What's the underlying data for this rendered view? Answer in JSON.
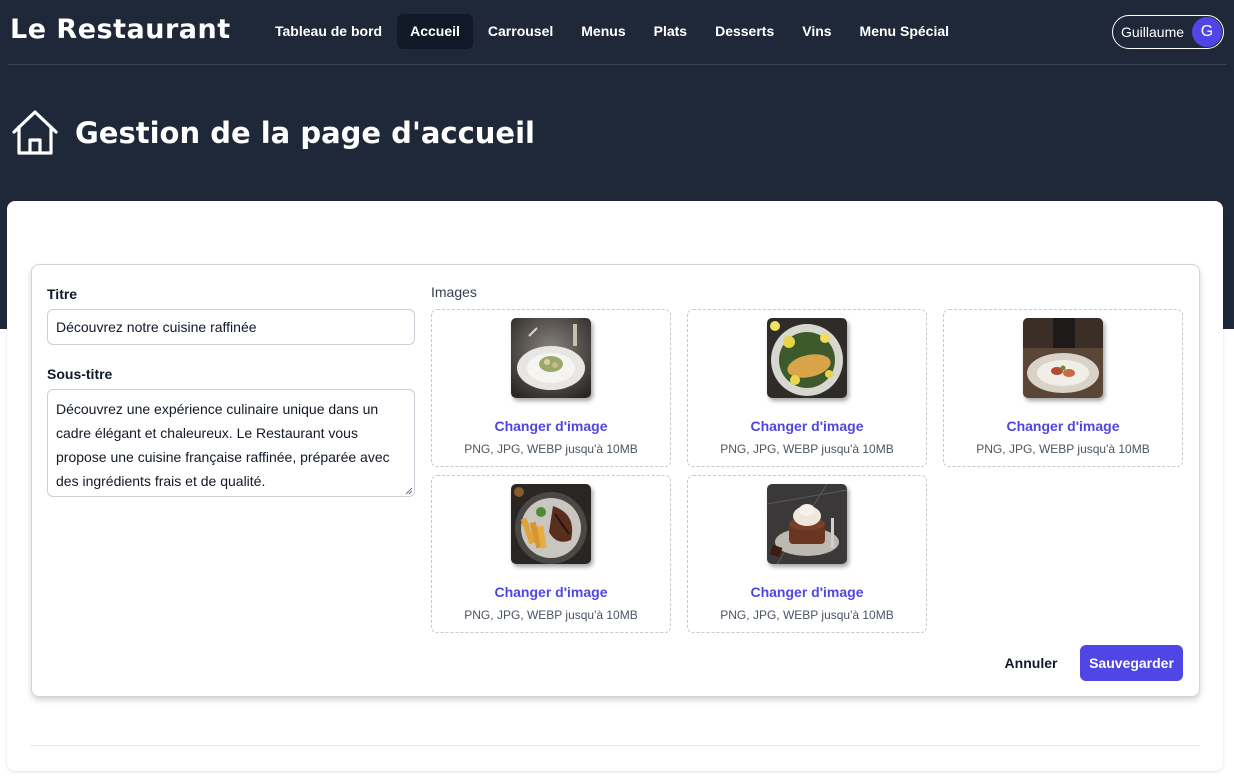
{
  "app": {
    "logo": "Le Restaurant"
  },
  "nav": {
    "items": [
      {
        "label": "Tableau de bord",
        "active": false
      },
      {
        "label": "Accueil",
        "active": true
      },
      {
        "label": "Carrousel",
        "active": false
      },
      {
        "label": "Menus",
        "active": false
      },
      {
        "label": "Plats",
        "active": false
      },
      {
        "label": "Desserts",
        "active": false
      },
      {
        "label": "Vins",
        "active": false
      },
      {
        "label": "Menu Spécial",
        "active": false
      }
    ]
  },
  "user": {
    "name": "Guillaume",
    "initial": "G",
    "avatar_color": "#4f46e5"
  },
  "page": {
    "title": "Gestion de la page d'accueil",
    "icon": "home-icon"
  },
  "form": {
    "title_label": "Titre",
    "title_value": "Découvrez notre cuisine raffinée",
    "subtitle_label": "Sous-titre",
    "subtitle_value": "Découvrez une expérience culinaire unique dans un cadre élégant et chaleureux. Le Restaurant vous propose une cuisine française raffinée, préparée avec des ingrédients frais et de qualité.",
    "images_label": "Images",
    "images": [
      {
        "dish": "plated-appetizer",
        "change_label": "Changer d'image",
        "hint": "PNG, JPG, WEBP jusqu'à 10MB"
      },
      {
        "dish": "fish-with-lemon",
        "change_label": "Changer d'image",
        "hint": "PNG, JPG, WEBP jusqu'à 10MB"
      },
      {
        "dish": "fine-dining-plate",
        "change_label": "Changer d'image",
        "hint": "PNG, JPG, WEBP jusqu'à 10MB"
      },
      {
        "dish": "steak-and-fries",
        "change_label": "Changer d'image",
        "hint": "PNG, JPG, WEBP jusqu'à 10MB"
      },
      {
        "dish": "chocolate-dessert",
        "change_label": "Changer d'image",
        "hint": "PNG, JPG, WEBP jusqu'à 10MB"
      }
    ],
    "cancel_label": "Annuler",
    "save_label": "Sauvegarder"
  },
  "colors": {
    "header_bg": "#1f2838",
    "accent": "#4f46e5",
    "active_nav_bg": "#111827"
  }
}
